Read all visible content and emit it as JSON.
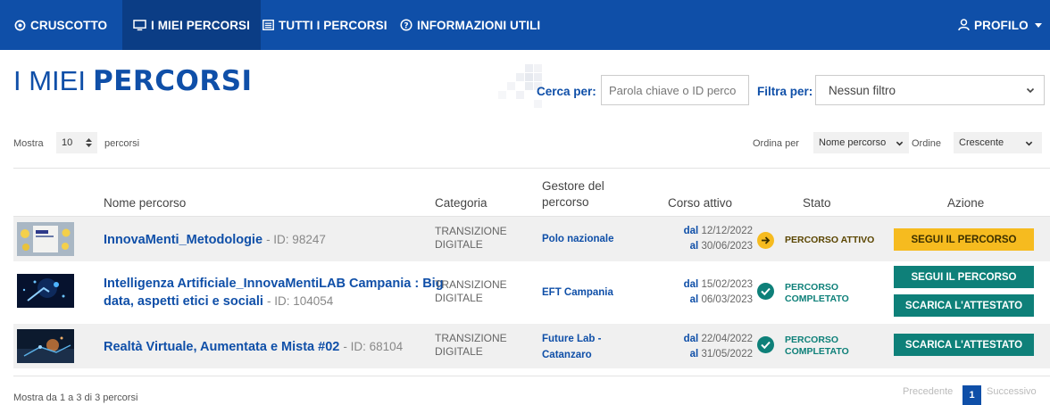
{
  "nav": {
    "dashboard": "CRUSCOTTO",
    "my_courses": "I MIEI PERCORSI",
    "all_courses": "TUTTI I PERCORSI",
    "info": "INFORMAZIONI UTILI",
    "profile": "PROFILO",
    "colors": {
      "bar": "#0f4fa8",
      "active": "#0b3d85"
    }
  },
  "page": {
    "title_thin": "I MIEI",
    "title_bold": "PERCORSI"
  },
  "search": {
    "label": "Cerca per:",
    "placeholder": "Parola chiave o ID perco"
  },
  "filter": {
    "label": "Filtra per:",
    "value": "Nessun filtro"
  },
  "toolbar": {
    "show_label": "Mostra",
    "page_size": "10",
    "show_suffix": "percorsi",
    "sort_label": "Ordina per",
    "sort_value": "Nome percorso",
    "order_label": "Ordine",
    "order_value": "Crescente"
  },
  "table": {
    "headers": {
      "name": "Nome percorso",
      "category": "Categoria",
      "manager_l1": "Gestore del",
      "manager_l2": "percorso",
      "active": "Corso attivo",
      "status": "Stato",
      "action": "Azione"
    },
    "rows": [
      {
        "name": "InnovaMenti_Metodologie",
        "id": "- ID: 98247",
        "category_l1": "TRANSIZIONE",
        "category_l2": "DIGITALE",
        "manager": "Polo nazionale",
        "from_label": "dal",
        "from": "12/12/2022",
        "to_label": "al",
        "to": "30/06/2023",
        "status_l1": "PERCORSO ATTIVO",
        "status_color": "#f6bb1f",
        "btn1": "SEGUI IL PERCORSO"
      },
      {
        "name_l1": "Intelligenza Artificiale_InnovaMentiLAB Campania : Big",
        "name_l2": "data, aspetti etici e sociali",
        "id": "- ID: 104054",
        "category_l1": "TRANSIZIONE",
        "category_l2": "DIGITALE",
        "manager": "EFT Campania",
        "from_label": "dal",
        "from": "15/02/2023",
        "to_label": "al",
        "to": "06/03/2023",
        "status_l1": "PERCORSO",
        "status_l2": "COMPLETATO",
        "status_color": "#0e8079",
        "btn1": "SEGUI IL PERCORSO",
        "btn2": "SCARICA L'ATTESTATO"
      },
      {
        "name": "Realtà Virtuale, Aumentata e Mista #02",
        "id": "- ID: 68104",
        "category_l1": "TRANSIZIONE",
        "category_l2": "DIGITALE",
        "manager_l1": "Future Lab -",
        "manager_l2": "Catanzaro",
        "from_label": "dal",
        "from": "22/04/2022",
        "to_label": "al",
        "to": "31/05/2022",
        "status_l1": "PERCORSO",
        "status_l2": "COMPLETATO",
        "status_color": "#0e8079",
        "btn1": "SCARICA L'ATTESTATO"
      }
    ]
  },
  "footer": {
    "summary": "Mostra da 1 a 3 di 3 percorsi",
    "prev": "Precedente",
    "page": "1",
    "next": "Successivo"
  }
}
